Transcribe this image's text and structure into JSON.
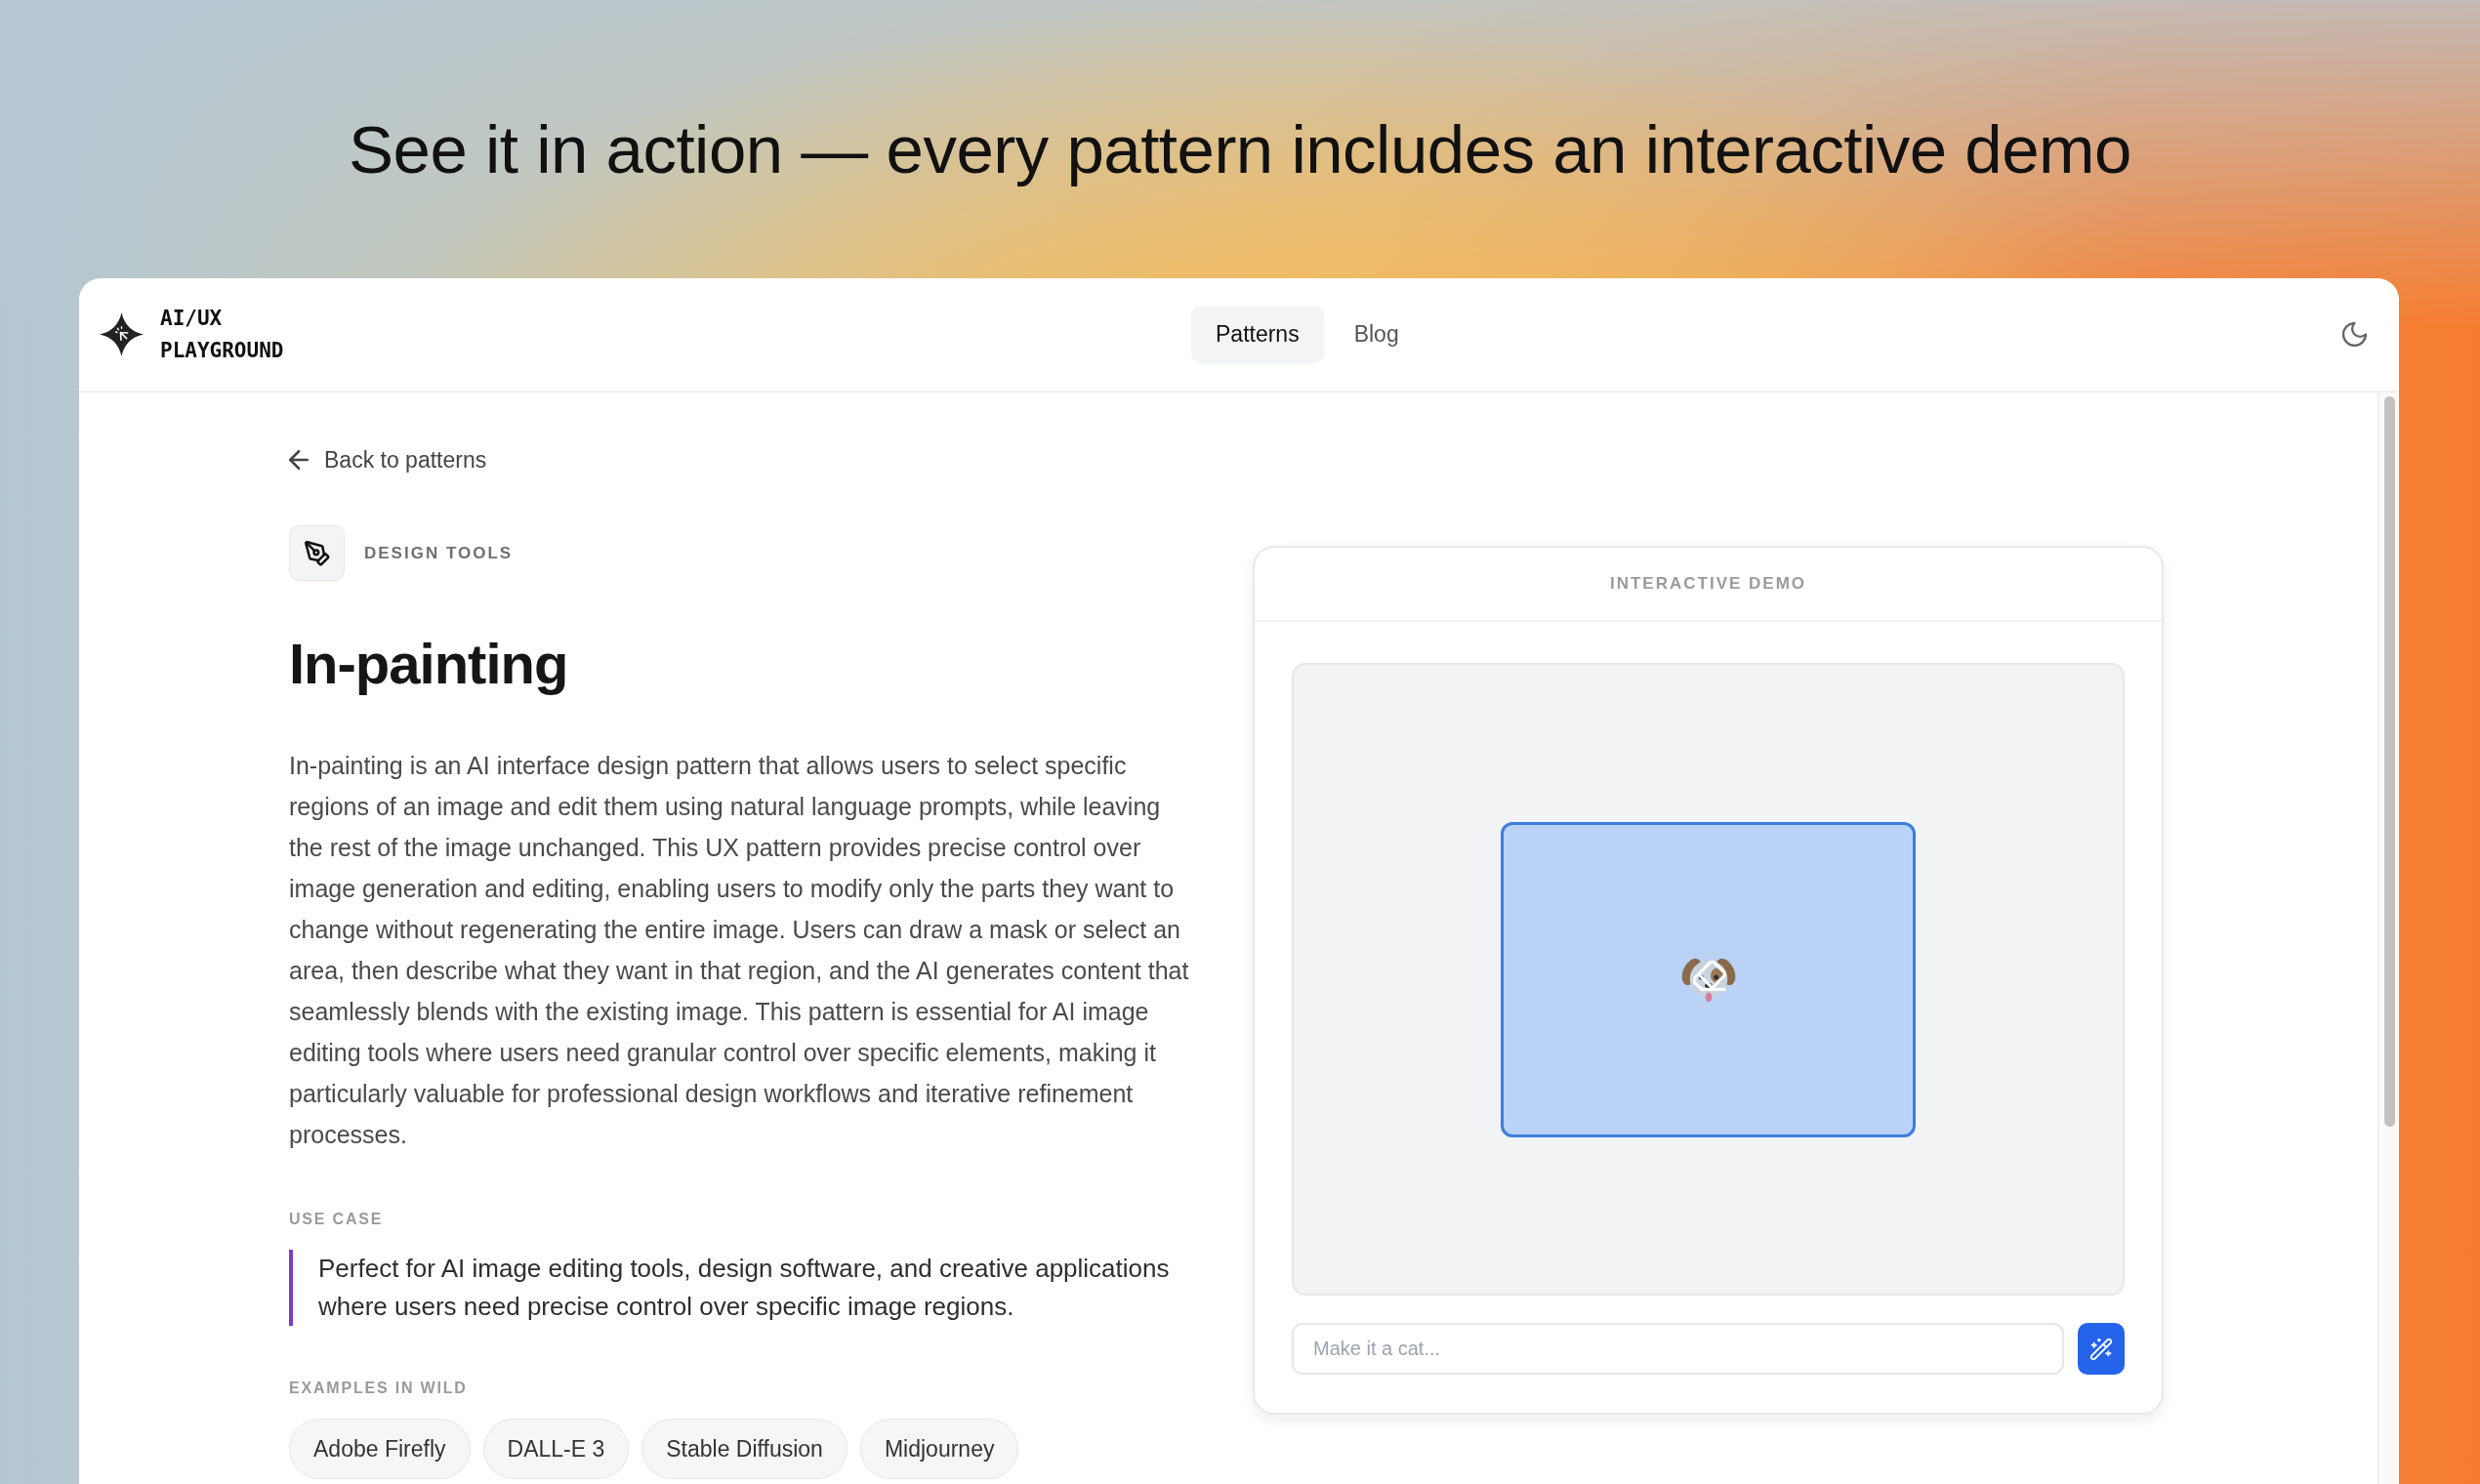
{
  "headline": "See it in action — every pattern includes an interactive demo",
  "window": {
    "logo_text": "AI/UX PLAYGROUND",
    "nav": [
      {
        "label": "Patterns",
        "selected": true
      },
      {
        "label": "Blog",
        "selected": false
      }
    ]
  },
  "pattern": {
    "back_link": "Back to patterns",
    "category": "DESIGN TOOLS",
    "title": "In-painting",
    "description": "In-painting is an AI interface design pattern that allows users to select specific regions of an image and edit them using natural language prompts, while leaving the rest of the image unchanged. This UX pattern provides precise control over image generation and editing, enabling users to modify only the parts they want to change without regenerating the entire image. Users can draw a mask or select an area, then describe what they want in that region, and the AI generates content that seamlessly blends with the existing image. This pattern is essential for AI image editing tools where users need granular control over specific elements, making it particularly valuable for professional design workflows and iterative refinement processes.",
    "use_case": {
      "label": "USE CASE",
      "text": "Perfect for AI image editing tools, design software, and creative applications where users need precise control over specific image regions."
    },
    "examples": {
      "label": "EXAMPLES IN WILD",
      "items": [
        "Adobe Firefly",
        "DALL-E 3",
        "Stable Diffusion",
        "Midjourney"
      ]
    }
  },
  "demo": {
    "title": "INTERACTIVE DEMO",
    "prompt": {
      "placeholder": "Make it a cat..."
    }
  }
}
